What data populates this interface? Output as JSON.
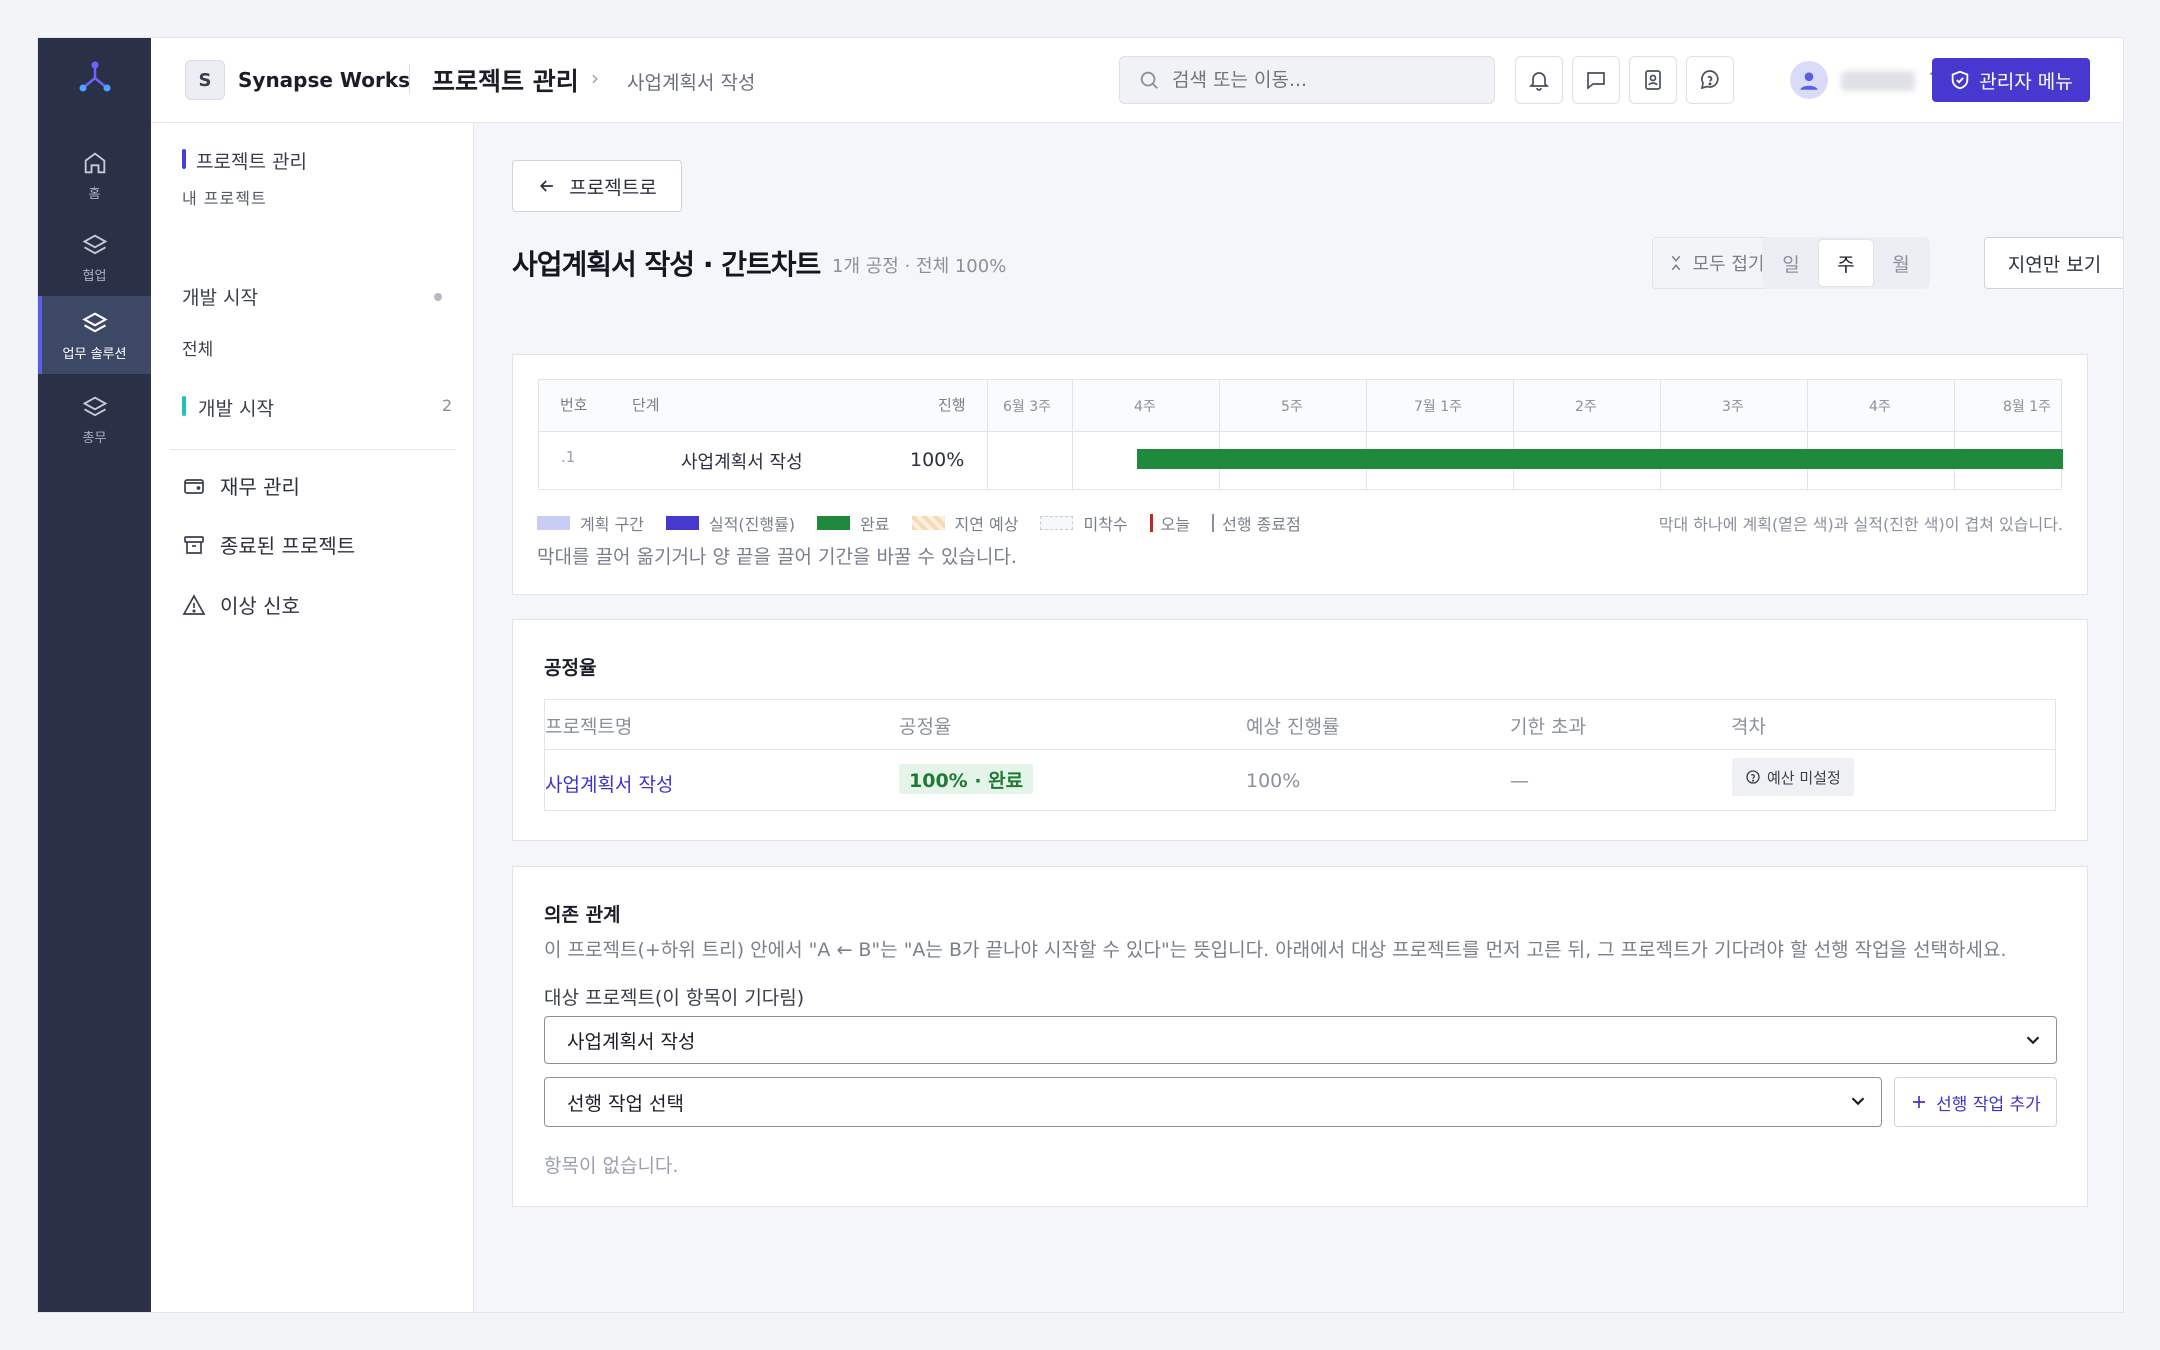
{
  "rail": {
    "items": [
      {
        "label": "홈",
        "icon": "home-icon"
      },
      {
        "label": "협업",
        "icon": "layers-icon"
      },
      {
        "label": "업무 솔루션",
        "icon": "layers-icon",
        "active": true
      },
      {
        "label": "총무",
        "icon": "layers-icon"
      }
    ]
  },
  "topbar": {
    "workspace_initial": "S",
    "workspace_name": "Synapse Works",
    "section_title": "프로젝트 관리",
    "breadcrumb_current": "사업계획서 작성",
    "search_placeholder": "검색 또는 이동...",
    "admin_menu_label": "관리자 메뉴"
  },
  "sidebar": {
    "header": "프로젝트 관리",
    "subheader": "내 프로젝트",
    "item_dev_start": "개발 시작",
    "item_all": "전체",
    "group_label": "개발 시작",
    "group_count": "2",
    "nav": [
      {
        "label": "재무 관리",
        "icon": "wallet-icon"
      },
      {
        "label": "종료된 프로젝트",
        "icon": "archive-icon"
      },
      {
        "label": "이상 신호",
        "icon": "warning-icon"
      }
    ]
  },
  "main": {
    "back_label": "프로젝트로",
    "title": "사업계획서 작성 · 간트차트",
    "meta": "1개 공정 · 전체 100%",
    "collapse_label": "모두 접기",
    "view_modes": [
      "일",
      "주",
      "월"
    ],
    "active_view": "주",
    "delay_only_label": "지연만 보기"
  },
  "gantt": {
    "headers": {
      "num": "번호",
      "stage": "단계",
      "progress": "진행"
    },
    "weeks": [
      "6월 3주",
      "4주",
      "5주",
      "7월 1주",
      "2주",
      "3주",
      "4주",
      "8월 1주"
    ],
    "rows": [
      {
        "num": ".1",
        "stage": "사업계획서 작성",
        "progress": "100%"
      }
    ],
    "legend": [
      {
        "label": "계획 구간",
        "kind": "swatch",
        "color": "#c9ccf5"
      },
      {
        "label": "실적(진행률)",
        "kind": "swatch",
        "color": "#4739d0"
      },
      {
        "label": "완료",
        "kind": "swatch",
        "color": "#1f8a3c"
      },
      {
        "label": "지연 예상",
        "kind": "hatched",
        "color": "#f7d9b3"
      },
      {
        "label": "미착수",
        "kind": "dashed",
        "color": "#d9dce4"
      },
      {
        "label": "오늘",
        "kind": "line",
        "color": "#c22727"
      },
      {
        "label": "선행 종료점",
        "kind": "line",
        "color": "#8b909d"
      }
    ],
    "legend_note": "막대 하나에 계획(옅은 색)과 실적(진한 색)이 겹쳐 있습니다.",
    "help": "막대를 끌어 옮기거나 양 끝을 끌어 기간을 바꿀 수 있습니다."
  },
  "progress_section": {
    "title": "공정율",
    "columns": [
      "프로젝트명",
      "공정율",
      "예상 진행률",
      "기한 초과",
      "격차"
    ],
    "row": {
      "name": "사업계획서 작성",
      "rate": "100% · 완료",
      "expected": "100%",
      "overdue": "—",
      "gap": "예산 미설정"
    }
  },
  "dependency": {
    "title": "의존 관계",
    "description": "이 프로젝트(+하위 트리) 안에서 \"A ← B\"는 \"A는 B가 끝나야 시작할 수 있다\"는 뜻입니다. 아래에서 대상 프로젝트를 먼저 고른 뒤, 그 프로젝트가 기다려야 할 선행 작업을 선택하세요.",
    "target_label": "대상 프로젝트(이 항목이 기다림)",
    "target_value": "사업계획서 작성",
    "predecessor_value": "선행 작업 선택",
    "add_label": "선행 작업 추가",
    "empty": "항목이 없습니다."
  },
  "colors": {
    "accent": "#4739d0",
    "rail_bg": "#2a3146",
    "done_green": "#1f8a3c"
  }
}
